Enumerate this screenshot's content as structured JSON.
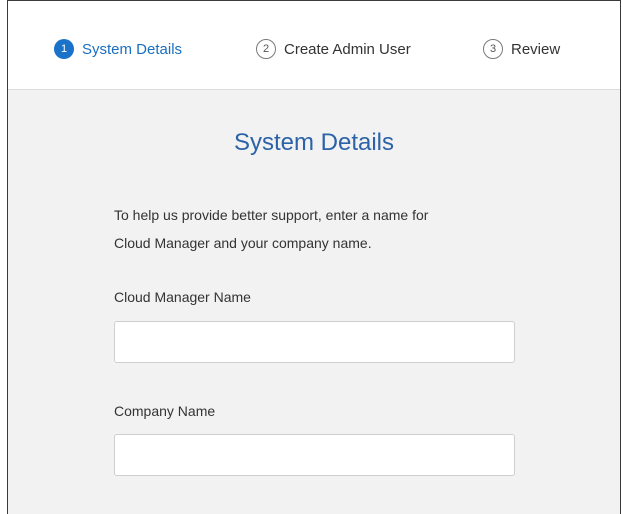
{
  "stepper": {
    "steps": [
      {
        "number": "1",
        "label": "System Details",
        "state": "active"
      },
      {
        "number": "2",
        "label": "Create Admin User",
        "state": "inactive"
      },
      {
        "number": "3",
        "label": "Review",
        "state": "inactive"
      }
    ]
  },
  "form": {
    "title": "System Details",
    "intro_line1": "To help us provide better support, enter a name for",
    "intro_line2": "Cloud Manager and your company name.",
    "fields": [
      {
        "label": "Cloud Manager Name",
        "value": ""
      },
      {
        "label": "Company Name",
        "value": ""
      }
    ]
  },
  "colors": {
    "accent": "#1a73c8",
    "title": "#2b62a8",
    "panel_background": "#f2f2f2"
  }
}
